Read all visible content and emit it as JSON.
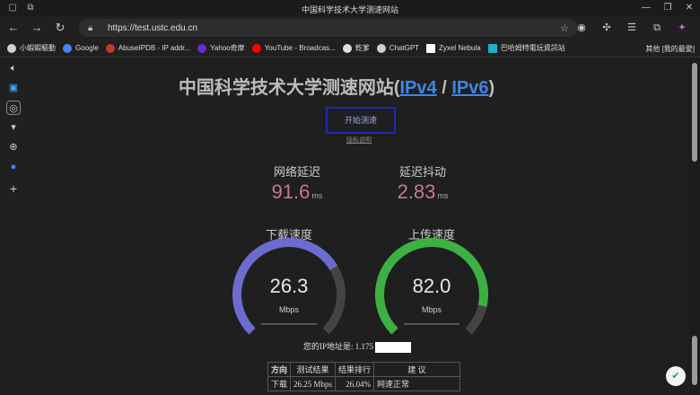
{
  "window": {
    "title": "中国科学技术大学测速网站",
    "controls": [
      "—",
      "❐",
      "✕"
    ]
  },
  "nav": {
    "url": "https://test.ustc.edu.cn"
  },
  "bookmarks": [
    {
      "label": "小蝦蝦驅動",
      "color": "#cfcfcf"
    },
    {
      "label": "Google",
      "color": "#4285f4"
    },
    {
      "label": "AbuseIPDB - IP addr...",
      "color": "#c0392b"
    },
    {
      "label": "Yahoo奇摩",
      "color": "#6b2bd9"
    },
    {
      "label": "YouTube - Broadcas...",
      "color": "#ff0000"
    },
    {
      "label": "乾爹",
      "color": "#e0e0e0"
    },
    {
      "label": "ChatGPT",
      "color": "#cfcfcf"
    },
    {
      "label": "Zyxel Nebula",
      "color": "#ffffff"
    },
    {
      "label": "巴哈姆特電玩資訊站",
      "color": "#1ab2c4"
    }
  ],
  "bookmarks_other": "其他 [我的最愛]",
  "page": {
    "title_prefix": "中国科学技术大学测速网站(",
    "ipv4": "IPv4",
    "slash": " / ",
    "ipv6": "IPv6",
    "title_suffix": ")",
    "start_button": "开始测速",
    "privacy": "隐私说明"
  },
  "metrics": {
    "ping_label": "网络延迟",
    "ping_value": "91.6",
    "ping_unit": "ms",
    "jitter_label": "延迟抖动",
    "jitter_value": "2.83",
    "jitter_unit": "ms"
  },
  "gauges": {
    "download": {
      "label": "下载速度",
      "value": "26.3",
      "unit": "Mbps",
      "fill": 0.72,
      "color": "#6c6ccf"
    },
    "upload": {
      "label": "上传速度",
      "value": "82.0",
      "unit": "Mbps",
      "fill": 0.88,
      "color": "#3cb043"
    }
  },
  "ip": {
    "label": "您的IP地址是: 1.175"
  },
  "results_table": {
    "headers": [
      "方向",
      "测试结果",
      "结果排行",
      "建 议"
    ],
    "rows": [
      [
        "下载",
        "26.25 Mbps",
        "26.04%",
        "网速正常"
      ]
    ]
  }
}
